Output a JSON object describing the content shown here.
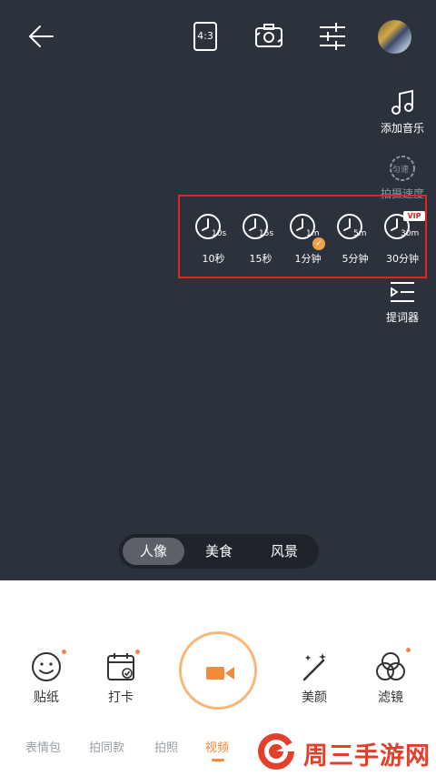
{
  "header": {
    "ratio_label": "4:3"
  },
  "side_tools": {
    "music_label": "添加音乐",
    "speed_badge": "匀速",
    "speed_label": "拍摄速度",
    "prompter_label": "提词器"
  },
  "duration_panel": {
    "vip_badge": "VIP",
    "items": [
      {
        "sub": "10s",
        "label": "10秒"
      },
      {
        "sub": "15s",
        "label": "15秒"
      },
      {
        "sub": "1m",
        "label": "1分钟"
      },
      {
        "sub": "5m",
        "label": "5分钟"
      },
      {
        "sub": "30m",
        "label": "30分钟"
      }
    ]
  },
  "mode_switch": {
    "items": [
      "人像",
      "美食",
      "风景"
    ],
    "active": "人像"
  },
  "bottom_tools": {
    "sticker_label": "贴纸",
    "checkin_label": "打卡",
    "beauty_label": "美颜",
    "filter_label": "滤镜"
  },
  "bottom_tabs": {
    "items": [
      "表情包",
      "拍同款",
      "拍照",
      "视频"
    ],
    "active": "视频"
  },
  "watermark": {
    "text": "周三手游网"
  },
  "colors": {
    "accent": "#f28a3c",
    "highlight_border": "#e02424",
    "camera_bg": "#2c323b"
  }
}
